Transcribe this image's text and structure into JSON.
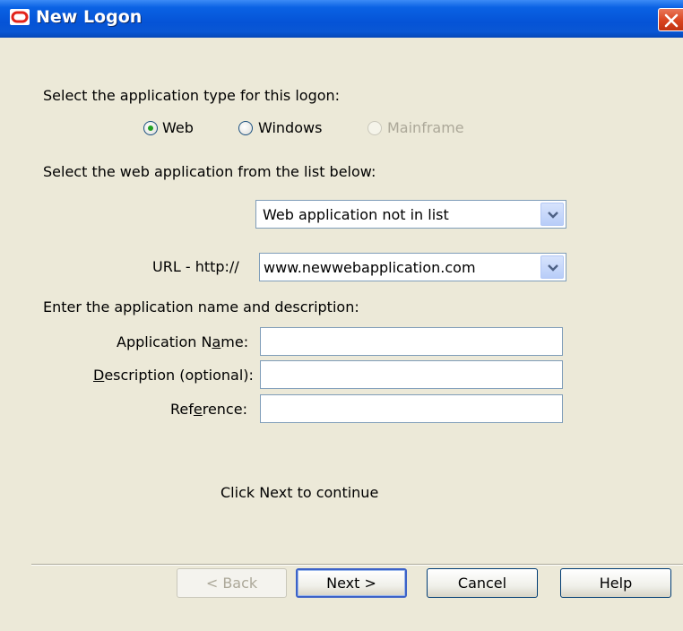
{
  "window": {
    "title": "New Logon"
  },
  "app_type": {
    "prompt": "Select the application type for this logon:",
    "options": [
      {
        "label": "Web",
        "selected": true,
        "enabled": true
      },
      {
        "label": "Windows",
        "selected": false,
        "enabled": true
      },
      {
        "label": "Mainframe",
        "selected": false,
        "enabled": false
      }
    ]
  },
  "web_app": {
    "prompt": "Select the web application from the list below:",
    "selected": "Web application not in list"
  },
  "url": {
    "label": "URL - http://",
    "value": "www.newwebapplication.com"
  },
  "details": {
    "prompt": "Enter the application name and description:",
    "name_label": "Application Name:",
    "name_value": "",
    "description_label": "Description (optional):",
    "description_value": "",
    "reference_label": "Reference:",
    "reference_value": ""
  },
  "hint": "Click Next to continue",
  "buttons": {
    "back": "< Back",
    "next": "Next >",
    "cancel": "Cancel",
    "help": "Help"
  },
  "colors": {
    "title_bar": "#0553D6",
    "dialog_bg": "#ECE9D8",
    "close_button": "#D9441F"
  }
}
